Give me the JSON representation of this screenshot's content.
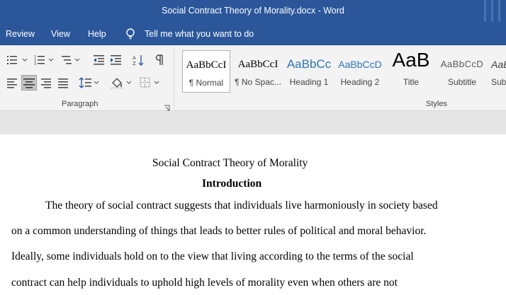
{
  "titlebar": {
    "title": "Social Contract Theory of Morality.docx  -  Word"
  },
  "menu": {
    "review": "Review",
    "view": "View",
    "help": "Help",
    "tell_me": "Tell me what you want to do"
  },
  "ribbon": {
    "paragraph_group_label": "Paragraph",
    "styles_group_label": "Styles",
    "styles": [
      {
        "sample": "AaBbCcI",
        "name": "¶ Normal"
      },
      {
        "sample": "AaBbCcI",
        "name": "¶ No Spac..."
      },
      {
        "sample": "AaBbCc",
        "name": "Heading 1"
      },
      {
        "sample": "AaBbCcD",
        "name": "Heading 2"
      },
      {
        "sample": "AaB",
        "name": "Title"
      },
      {
        "sample": "AaBbCcD",
        "name": "Subtitle"
      },
      {
        "sample": "AaB",
        "name": "Subt"
      }
    ],
    "colors": {
      "heading": "#2e74b5",
      "accent_blue": "#2b579a"
    }
  },
  "document": {
    "title": "Social Contract Theory of Morality",
    "heading": "Introduction",
    "lines": [
      "The theory of social contract suggests that individuals live harmoniously in society based",
      "on a common understanding of things that leads to better rules of political and moral behavior.",
      "Ideally, some individuals hold on to the view that living according to the terms of the social",
      "contract can help individuals to uphold high levels of morality even when others are not"
    ]
  }
}
